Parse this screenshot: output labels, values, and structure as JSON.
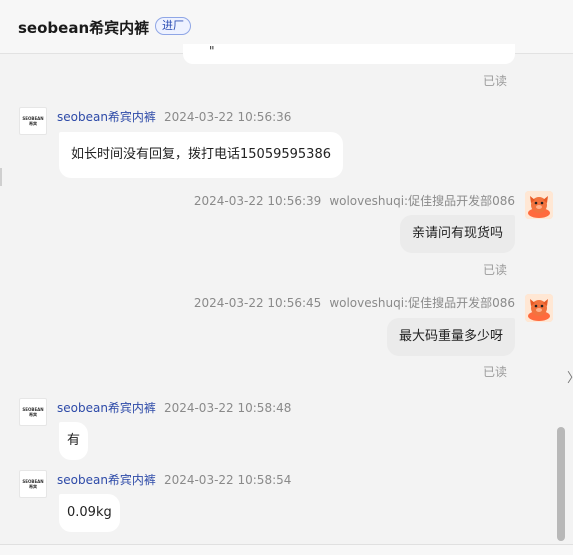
{
  "header": {
    "title": "seobean希宾内裤",
    "badge": "进厂"
  },
  "prev_bubble_partial": "\"",
  "shop": {
    "avatar_logo": "SEOBEAN 希宾"
  },
  "messages": [
    {
      "side": "left",
      "sender": "seobean希宾内裤",
      "time": "2024-03-22 10:56:36",
      "text": "如长时间没有回复，拨打电话15059595386"
    },
    {
      "side": "right",
      "sender": "woloveshuqi:促佳搜品开发部086",
      "time": "2024-03-22 10:56:39",
      "text": "亲请问有现货吗",
      "status": "已读"
    },
    {
      "side": "right",
      "sender": "woloveshuqi:促佳搜品开发部086",
      "time": "2024-03-22 10:56:45",
      "text": "最大码重量多少呀",
      "status": "已读"
    },
    {
      "side": "left",
      "sender": "seobean希宾内裤",
      "time": "2024-03-22 10:58:48",
      "text": "有"
    },
    {
      "side": "left",
      "sender": "seobean希宾内裤",
      "time": "2024-03-22 10:58:54",
      "text": "0.09kg"
    }
  ],
  "read_status_top": "已读",
  "side_arrow": "〉",
  "icons": {
    "user_avatar": "pig-avatar-icon",
    "scroll": "scrollbar"
  }
}
